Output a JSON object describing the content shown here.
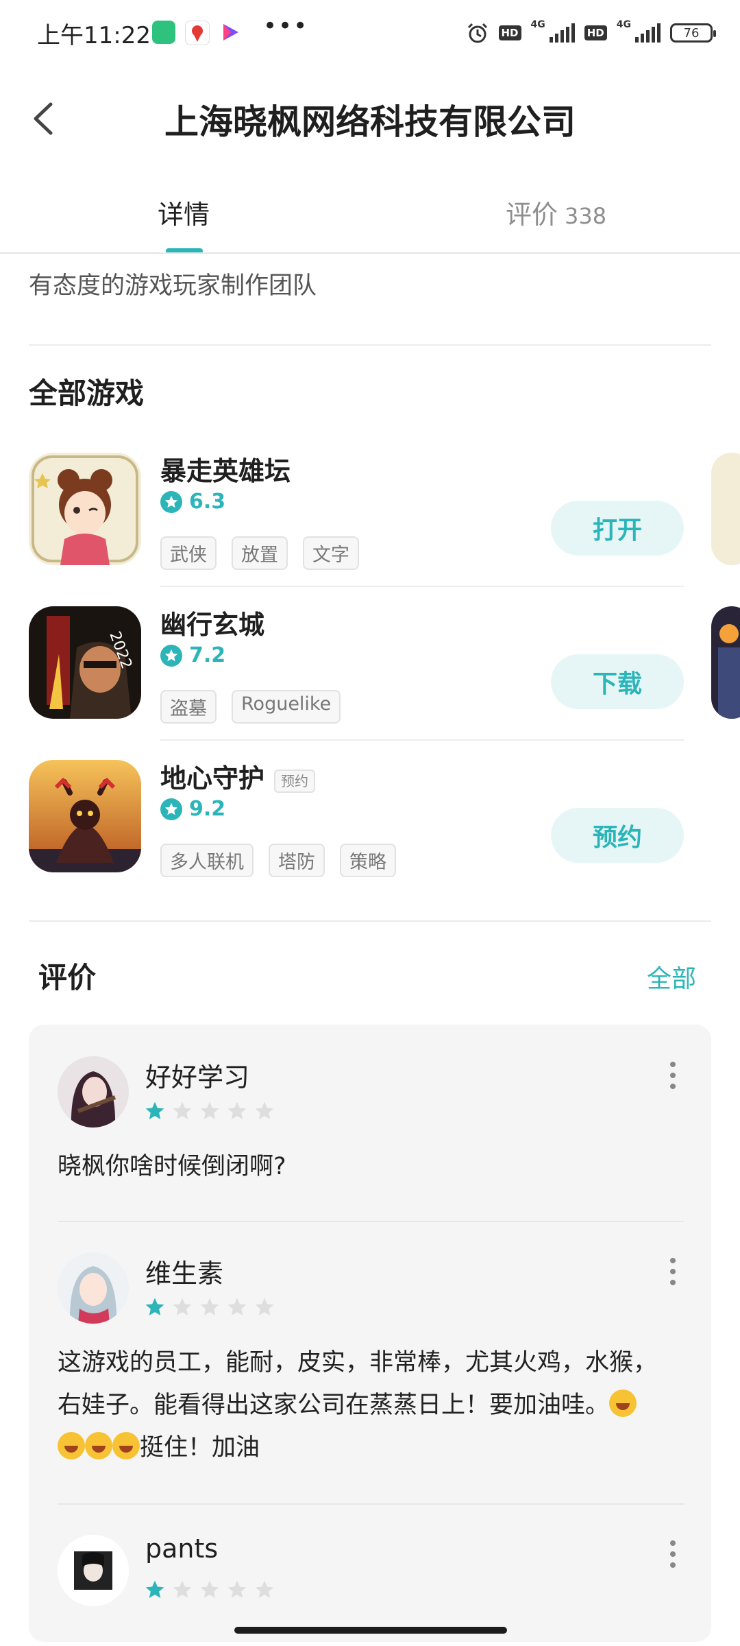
{
  "status_bar": {
    "time": "上午11:22",
    "network_1": "4G",
    "network_2": "4G",
    "hd_label": "HD",
    "battery": "76"
  },
  "header": {
    "title": "上海晓枫网络科技有限公司"
  },
  "tabs": {
    "details_label": "详情",
    "reviews_label": "评价",
    "reviews_count": "338"
  },
  "intro": "有态度的游戏玩家制作团队",
  "games_section": {
    "title": "全部游戏"
  },
  "games": [
    {
      "name": "暴走英雄坛",
      "rating": "6.3",
      "tags": [
        "武侠",
        "放置",
        "文字"
      ],
      "action": "打开",
      "badge": ""
    },
    {
      "name": "幽行玄城",
      "rating": "7.2",
      "tags": [
        "盗墓",
        "Roguelike"
      ],
      "action": "下载",
      "badge": ""
    },
    {
      "name": "地心守护",
      "rating": "9.2",
      "tags": [
        "多人联机",
        "塔防",
        "策略"
      ],
      "action": "预约",
      "badge": "预约"
    }
  ],
  "reviews_section": {
    "title": "评价",
    "all_label": "全部"
  },
  "reviews": [
    {
      "user": "好好学习",
      "stars": 1,
      "text": "晓枫你啥时候倒闭啊?"
    },
    {
      "user": "维生素",
      "stars": 1,
      "text_line1": "这游戏的员工，能耐，皮实，非常棒，尤其火鸡，水猴，",
      "text_line2": "右娃子。能看得出这家公司在蒸蒸日上！要加油哇。",
      "text_line3": "挺住！加油"
    },
    {
      "user": "pants",
      "stars": 1
    }
  ],
  "colors": {
    "accent": "#2bb5b9",
    "accent_bg": "#e6f6f6",
    "card_bg": "#f5f5f5"
  }
}
